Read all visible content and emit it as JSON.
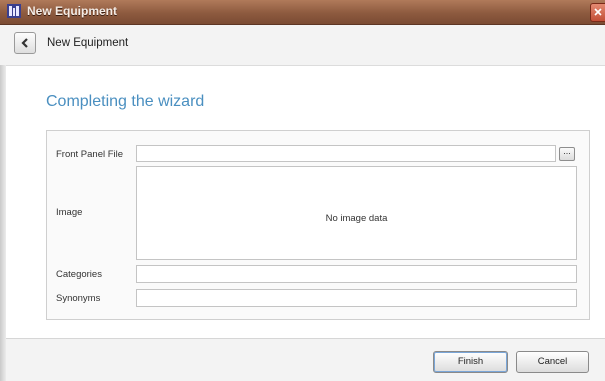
{
  "window": {
    "title": "New Equipment"
  },
  "nav": {
    "title": "New Equipment"
  },
  "page": {
    "heading": "Completing the wizard"
  },
  "form": {
    "front_panel_label": "Front Panel File",
    "front_panel_value": "",
    "browse_label": "...",
    "image_label": "Image",
    "image_placeholder": "No image data",
    "categories_label": "Categories",
    "categories_value": "",
    "synonyms_label": "Synonyms",
    "synonyms_value": ""
  },
  "buttons": {
    "finish": "Finish",
    "cancel": "Cancel"
  },
  "colors": {
    "titlebar": "#8d5a3f",
    "heading": "#4a8fc0"
  }
}
